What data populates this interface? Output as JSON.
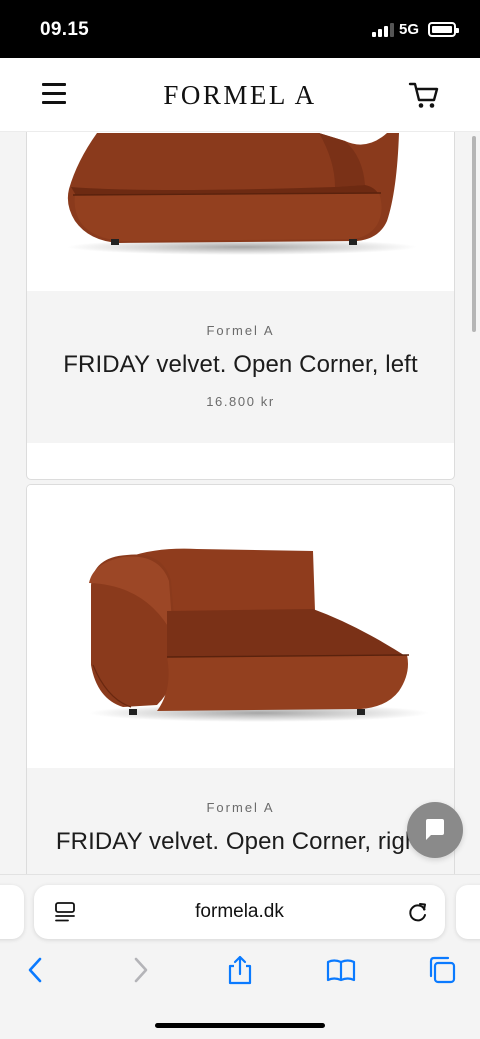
{
  "status_bar": {
    "time": "09.15",
    "network": "5G",
    "signal_bars_active": 3,
    "signal_bars_total": 4,
    "battery_level": 1.0
  },
  "header": {
    "brand": "FORMEL A",
    "menu_icon": "hamburger-menu-icon",
    "cart_icon": "shopping-cart-icon"
  },
  "products": [
    {
      "vendor": "Formel A",
      "title": "FRIDAY velvet. Open Corner, left",
      "price": "16.800 kr",
      "color": "#8a3a1c"
    },
    {
      "vendor": "Formel A",
      "title": "FRIDAY velvet. Open Corner, right",
      "color": "#8a3a1c"
    }
  ],
  "chat": {
    "icon": "chat-bubble-icon",
    "color": "#8a8a8a"
  },
  "browser": {
    "url": "formela.dk",
    "reader_icon": "page-menu-icon",
    "reload_icon": "reload-icon",
    "toolbar": [
      "back-icon",
      "forward-icon",
      "share-icon",
      "bookmarks-icon",
      "tabs-icon"
    ],
    "accent": "#0a7aff",
    "disabled": "#b4b4b8"
  }
}
